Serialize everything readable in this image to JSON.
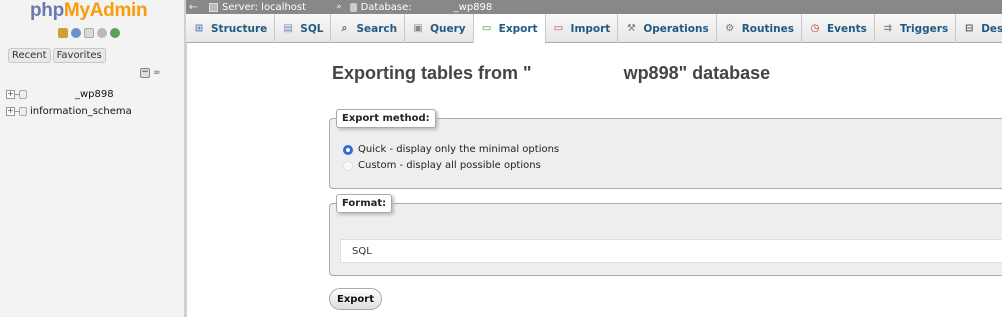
{
  "nav": {
    "logo": {
      "part1": "php",
      "part2": "MyAdmin"
    },
    "icons": [
      "home-icon",
      "logout-icon",
      "docs-icon",
      "settings-icon",
      "reload-icon"
    ],
    "tabs": {
      "recent": "Recent",
      "favorites": "Favorites"
    },
    "collapse_link": "∞",
    "databases": [
      {
        "name": "_wp898"
      },
      {
        "name": "information_schema"
      }
    ]
  },
  "breadcrumb": {
    "server_label": "Server: localhost",
    "separator": "»",
    "database_label": "Database:",
    "database_name": "_wp898"
  },
  "menu": {
    "tabs": [
      {
        "label": "Structure",
        "icon": "structure-icon"
      },
      {
        "label": "SQL",
        "icon": "sql-icon"
      },
      {
        "label": "Search",
        "icon": "search-icon"
      },
      {
        "label": "Query",
        "icon": "query-icon"
      },
      {
        "label": "Export",
        "icon": "export-icon",
        "active": true
      },
      {
        "label": "Import",
        "icon": "import-icon"
      },
      {
        "label": "Operations",
        "icon": "wrench-icon"
      },
      {
        "label": "Routines",
        "icon": "routines-icon"
      },
      {
        "label": "Events",
        "icon": "clock-icon"
      },
      {
        "label": "Triggers",
        "icon": "triggers-icon"
      },
      {
        "label": "Designer",
        "icon": "designer-icon"
      }
    ]
  },
  "main": {
    "title_prefix": "Exporting tables from \"",
    "title_suffix": "wp898\" database",
    "export_method": {
      "legend": "Export method:",
      "options": [
        {
          "label": "Quick - display only the minimal options",
          "selected": true
        },
        {
          "label": "Custom - display all possible options",
          "selected": false
        }
      ]
    },
    "format": {
      "legend": "Format:",
      "selected": "SQL"
    },
    "export_button": "Export"
  },
  "colors": {
    "tab_text": "#235a81",
    "logo_php": "#6c78af",
    "logo_myadmin": "#f89c0e",
    "radio_selected": "#2f6bd7"
  }
}
